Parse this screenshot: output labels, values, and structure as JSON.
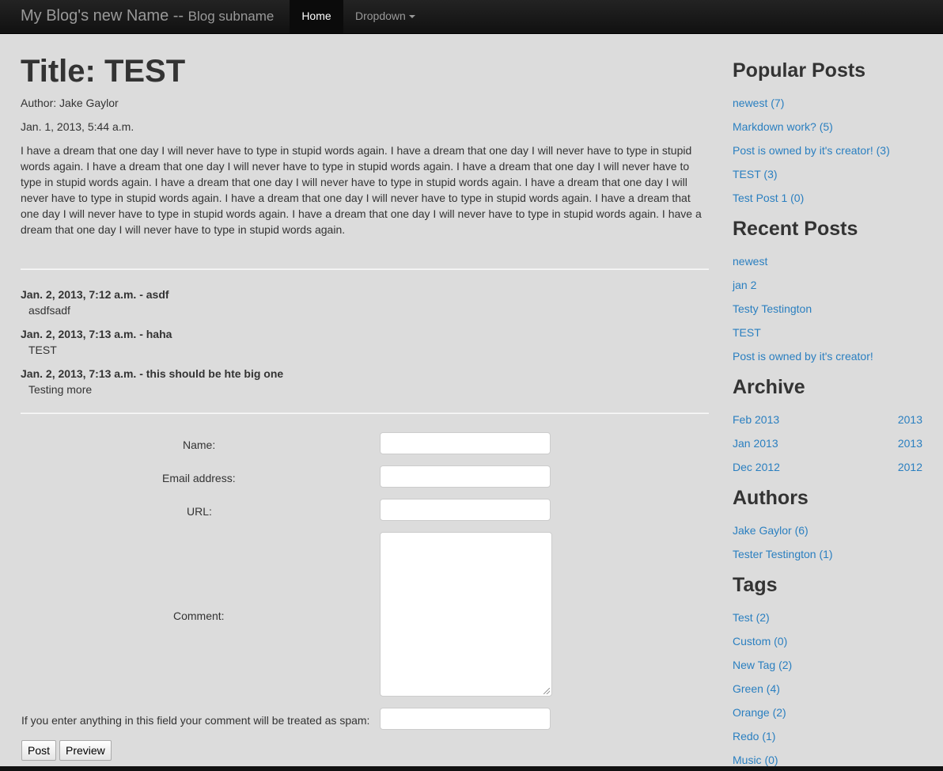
{
  "navbar": {
    "brand": "My Blog's new Name --",
    "brand_sub": "Blog subname",
    "home": "Home",
    "dropdown": "Dropdown"
  },
  "post": {
    "title": "Title: TEST",
    "author": "Author: Jake Gaylor",
    "date": "Jan. 1, 2013, 5:44 a.m.",
    "body": "I have a dream that one day I will never have to type in stupid words again. I have a dream that one day I will never have to type in stupid words again. I have a dream that one day I will never have to type in stupid words again. I have a dream that one day I will never have to type in stupid words again. I have a dream that one day I will never have to type in stupid words again. I have a dream that one day I will never have to type in stupid words again. I have a dream that one day I will never have to type in stupid words again. I have a dream that one day I will never have to type in stupid words again. I have a dream that one day I will never have to type in stupid words again. I have a dream that one day I will never have to type in stupid words again."
  },
  "comments": [
    {
      "head": "Jan. 2, 2013, 7:12 a.m. - asdf",
      "text": "asdfsadf"
    },
    {
      "head": "Jan. 2, 2013, 7:13 a.m. - haha",
      "text": "TEST"
    },
    {
      "head": "Jan. 2, 2013, 7:13 a.m. - this should be hte big one",
      "text": "Testing more"
    }
  ],
  "form": {
    "name_label": "Name:",
    "email_label": "Email address:",
    "url_label": "URL:",
    "comment_label": "Comment:",
    "spam_label": "If you enter anything in this field your comment will be treated as spam:",
    "post_button": "Post",
    "preview_button": "Preview"
  },
  "sidebar": {
    "popular_title": "Popular Posts",
    "popular": [
      "newest (7)",
      "Markdown work? (5)",
      "Post is owned by it's creator! (3)",
      "TEST (3)",
      "Test Post 1 (0)"
    ],
    "recent_title": "Recent Posts",
    "recent": [
      "newest",
      "jan 2",
      "Testy Testington",
      "TEST",
      "Post is owned by it's creator!"
    ],
    "archive_title": "Archive",
    "archive": [
      {
        "month": "Feb 2013",
        "year": "2013"
      },
      {
        "month": "Jan 2013",
        "year": "2013"
      },
      {
        "month": "Dec 2012",
        "year": "2012"
      }
    ],
    "authors_title": "Authors",
    "authors": [
      "Jake Gaylor (6)",
      "Tester Testington (1)"
    ],
    "tags_title": "Tags",
    "tags": [
      "Test (2)",
      "Custom (0)",
      "New Tag (2)",
      "Green (4)",
      "Orange (2)",
      "Redo (1)",
      "Music (0)"
    ]
  },
  "colors": {
    "link": "#2a7fc0",
    "background": "#dcdcdc",
    "navbar": "#111111"
  }
}
